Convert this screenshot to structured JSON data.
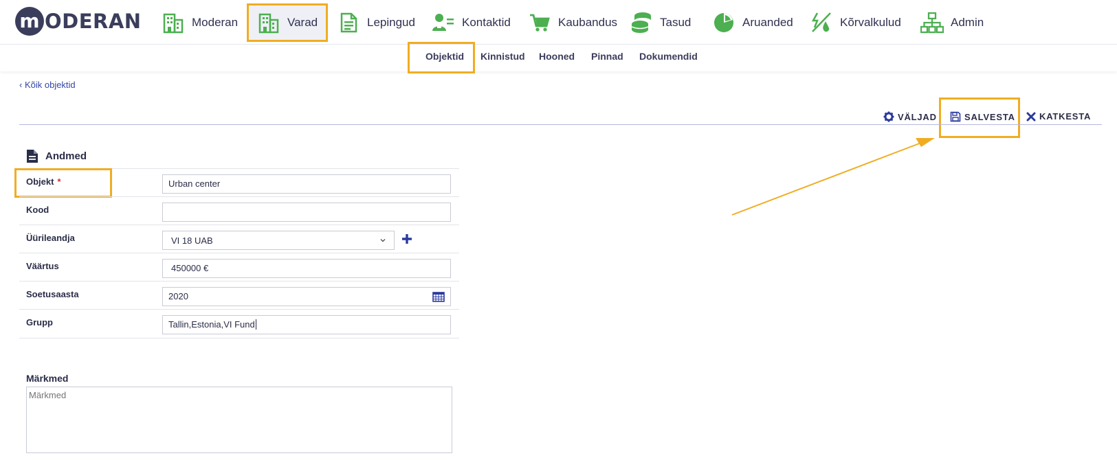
{
  "app": {
    "logo_letter": "m",
    "logo_text": "ODERAN"
  },
  "nav": {
    "items": [
      {
        "label": "Moderan",
        "icon": "building-icon"
      },
      {
        "label": "Varad",
        "icon": "building-icon"
      },
      {
        "label": "Lepingud",
        "icon": "document-icon"
      },
      {
        "label": "Kontaktid",
        "icon": "contact-card-icon"
      },
      {
        "label": "Kaubandus",
        "icon": "shopping-cart-icon"
      },
      {
        "label": "Tasud",
        "icon": "coins-stack-icon"
      },
      {
        "label": "Aruanded",
        "icon": "pie-chart-icon"
      },
      {
        "label": "Kõrvalkulud",
        "icon": "utilities-icon"
      },
      {
        "label": "Admin",
        "icon": "org-chart-icon"
      }
    ],
    "active": "Varad",
    "icon_color": "#4caf50"
  },
  "subnav": {
    "items": [
      "Objektid",
      "Kinnistud",
      "Hooned",
      "Pinnad",
      "Dokumendid"
    ],
    "active": "Objektid"
  },
  "back_link": "Kõik objektid",
  "toolbar": {
    "fields_label": "VÄLJAD",
    "save_label": "SALVESTA",
    "cancel_label": "KATKESTA"
  },
  "form": {
    "section_title": "Andmed",
    "fields": [
      {
        "label": "Objekt",
        "value": "Urban center",
        "required": true
      },
      {
        "label": "Kood",
        "value": ""
      },
      {
        "label": "Üürileandja",
        "value": "VI 18 UAB"
      },
      {
        "label": "Väärtus",
        "value": "450000 €"
      },
      {
        "label": "Soetusaasta",
        "value": "2020"
      },
      {
        "label": "Grupp",
        "value": "Tallin,Estonia,VI Fund"
      }
    ],
    "required_mark": "*",
    "notes_label": "Märkmed",
    "notes_placeholder": "Märkmed"
  },
  "colors": {
    "highlight": "#f0ad22",
    "accent_blue": "#2b3a9e",
    "text_dark": "#2a2d47"
  }
}
